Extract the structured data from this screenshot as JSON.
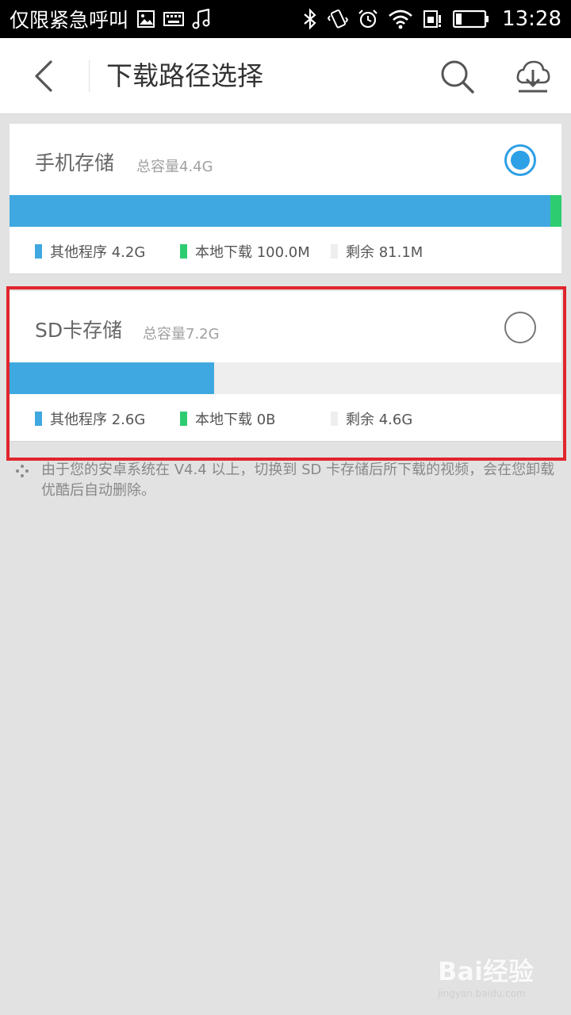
{
  "status_bar": {
    "carrier": "仅限紧急呼叫",
    "time": "13:28",
    "icons": [
      "gallery-icon",
      "keyboard-icon",
      "music-icon",
      "bluetooth-icon",
      "vibrate-icon",
      "alarm-icon",
      "wifi-icon",
      "sim-icon",
      "battery-icon"
    ]
  },
  "header": {
    "title": "下载路径选择",
    "icons": [
      "back-icon",
      "search-icon",
      "download-icon"
    ]
  },
  "storages": {
    "phone": {
      "title": "手机存储",
      "capacity": "总容量4.4G",
      "selected": true,
      "other_fraction": 0.98,
      "local_fraction": 0.02,
      "legend": {
        "other": "其他程序 4.2G",
        "local": "本地下载 100.0M",
        "free": "剩余 81.1M"
      }
    },
    "sd": {
      "title": "SD卡存储",
      "capacity": "总容量7.2G",
      "selected": false,
      "other_fraction": 0.37,
      "local_fraction": 0.0,
      "legend": {
        "other": "其他程序 2.6G",
        "local": "本地下载 0B",
        "free": "剩余 4.6G"
      }
    }
  },
  "colors": {
    "other": "#40a8e0",
    "local": "#2ecc71",
    "free": "#eeeeee",
    "radio_selected": "#2ea0e6",
    "highlight": "#e0252c"
  },
  "note": {
    "text": "由于您的安卓系统在 V4.4 以上，切换到 SD 卡存储后所下载的视频，会在您卸载优酷后自动删除。"
  },
  "watermark": {
    "logo": "Bai经验",
    "url": "jingyan.baidu.com"
  }
}
